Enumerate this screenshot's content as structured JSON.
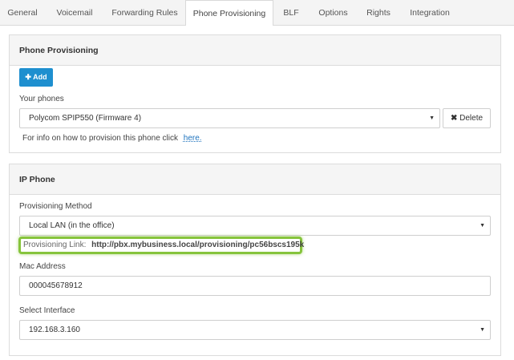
{
  "tabs": [
    {
      "label": "General"
    },
    {
      "label": "Voicemail"
    },
    {
      "label": "Forwarding Rules"
    },
    {
      "label": "Phone Provisioning"
    },
    {
      "label": "BLF"
    },
    {
      "label": "Options"
    },
    {
      "label": "Rights"
    },
    {
      "label": "Integration"
    }
  ],
  "active_tab": "Phone Provisioning",
  "phone_provisioning": {
    "title": "Phone Provisioning",
    "add_label": "Add",
    "your_phones_label": "Your phones",
    "selected_phone": "Polycom SPIP550 (Firmware 4)",
    "delete_label": "Delete",
    "info_text": "For info on how to provision this phone click",
    "info_link": "here."
  },
  "ip_phone": {
    "title": "IP Phone",
    "method_label": "Provisioning Method",
    "method_value": "Local LAN (in the office)",
    "link_label": "Provisioning Link:",
    "link_value": "http://pbx.mybusiness.local/provisioning/pc56bscs195k",
    "mac_label": "Mac Address",
    "mac_value": "000045678912",
    "interface_label": "Select Interface",
    "interface_value": "192.168.3.160"
  },
  "colors": {
    "accent": "#1e8fcf",
    "highlight": "#86c43c",
    "link": "#1e73be"
  },
  "icons": {
    "add": "plus-icon",
    "delete": "x-icon",
    "select": "caret-down-icon"
  }
}
